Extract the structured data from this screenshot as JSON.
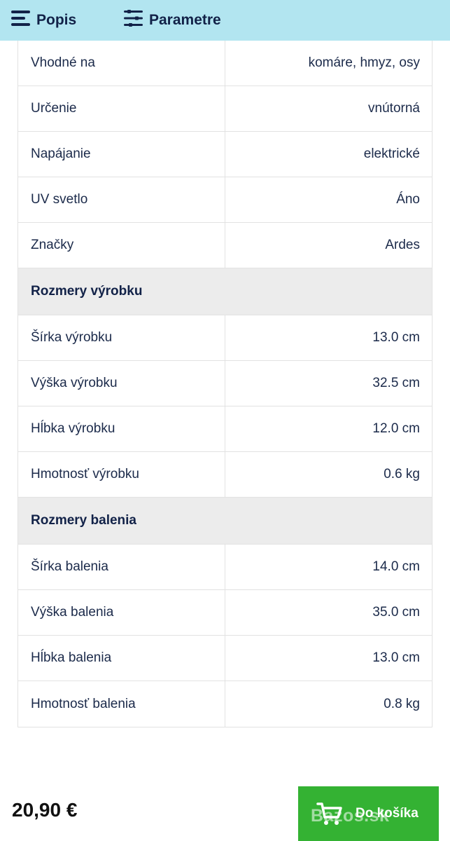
{
  "tabs": {
    "popis": "Popis",
    "parametre": "Parametre"
  },
  "params": [
    {
      "label": "Vhodné na",
      "value": "komáre, hmyz, osy"
    },
    {
      "label": "Určenie",
      "value": "vnútorná"
    },
    {
      "label": "Napájanie",
      "value": "elektrické"
    },
    {
      "label": "UV svetlo",
      "value": "Áno"
    },
    {
      "label": "Značky",
      "value": "Ardes"
    }
  ],
  "section_product": {
    "title": "Rozmery výrobku",
    "rows": [
      {
        "label": "Šírka výrobku",
        "value": "13.0 cm"
      },
      {
        "label": "Výška výrobku",
        "value": "32.5 cm"
      },
      {
        "label": "Hĺbka výrobku",
        "value": "12.0 cm"
      },
      {
        "label": "Hmotnosť výrobku",
        "value": "0.6 kg"
      }
    ]
  },
  "section_package": {
    "title": "Rozmery balenia",
    "rows": [
      {
        "label": "Šírka balenia",
        "value": "14.0 cm"
      },
      {
        "label": "Výška balenia",
        "value": "35.0 cm"
      },
      {
        "label": "Hĺbka balenia",
        "value": "13.0 cm"
      },
      {
        "label": "Hmotnosť balenia",
        "value": "0.8 kg"
      }
    ]
  },
  "footer": {
    "price": "20,90 €",
    "cart_label": "Do košíka",
    "watermark": "Bazos.sk"
  },
  "colors": {
    "top_bar": "#b2e5f0",
    "cart_button": "#34b233",
    "section_bg": "#ececec"
  },
  "icons": {
    "popis": "menu-lines-icon",
    "parametre": "sliders-icon",
    "cart": "cart-icon"
  }
}
